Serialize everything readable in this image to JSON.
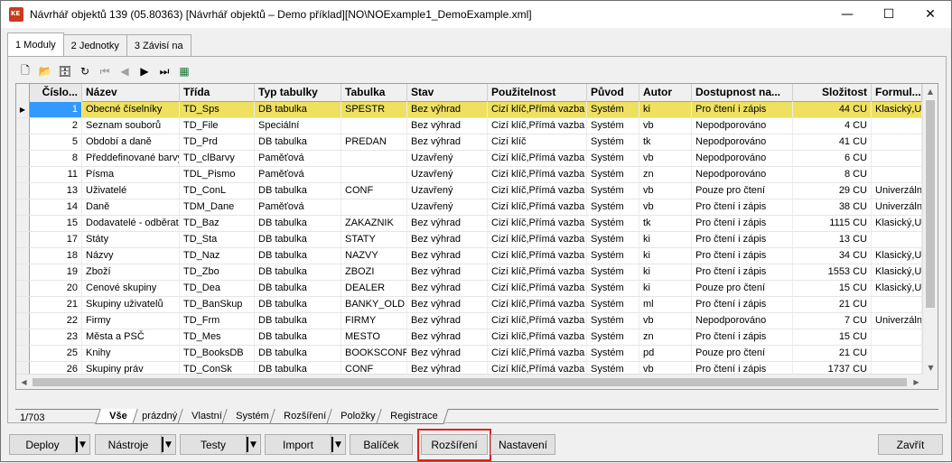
{
  "window": {
    "title": "Návrhář objektů 139 (05.80363) [Návrhář objektů – Demo příklad][NO\\NOExample1_DemoExample.xml]",
    "minimize": "—",
    "maximize": "☐",
    "close": "✕"
  },
  "top_tabs": [
    {
      "label": "1 Moduly",
      "active": true
    },
    {
      "label": "2 Jednotky",
      "active": false
    },
    {
      "label": "3 Závisí na",
      "active": false
    }
  ],
  "toolbar": {
    "icons": [
      "new-document-icon",
      "open-folder-icon",
      "database-icon",
      "refresh-icon",
      "first-record-icon",
      "previous-record-icon",
      "next-record-icon",
      "last-record-icon",
      "excel-export-icon"
    ],
    "glyphs": [
      "🗋",
      "📂",
      "🗄",
      "↻",
      "⏮",
      "◀",
      "▶",
      "⏭",
      "▦"
    ]
  },
  "grid": {
    "columns": [
      "Číslo...",
      "Název",
      "Třída",
      "Typ tabulky",
      "Tabulka",
      "Stav",
      "Použitelnost",
      "Původ",
      "Autor",
      "Dostupnost na...",
      "Složitost",
      "Formul..."
    ],
    "rows": [
      [
        "1",
        "Obecné číselníky",
        "TD_Sps",
        "DB tabulka",
        "SPESTR",
        "Bez výhrad",
        "Cizí klíč,Přímá vazba",
        "Systém",
        "ki",
        "Pro čtení i zápis",
        "44 CU",
        "Klasický,Un"
      ],
      [
        "2",
        "Seznam souborů",
        "TD_File",
        "Speciální",
        "",
        "Bez výhrad",
        "Cizí klíč,Přímá vazba",
        "Systém",
        "vb",
        "Nepodporováno",
        "4 CU",
        ""
      ],
      [
        "5",
        "Období a daně",
        "TD_Prd",
        "DB tabulka",
        "PREDAN",
        "Bez výhrad",
        "Cizí klíč",
        "Systém",
        "tk",
        "Nepodporováno",
        "41 CU",
        ""
      ],
      [
        "8",
        "Předdefinované barvy",
        "TD_clBarvy",
        "Paměťová",
        "",
        "Uzavřený",
        "Cizí klíč,Přímá vazba",
        "Systém",
        "vb",
        "Nepodporováno",
        "6 CU",
        ""
      ],
      [
        "11",
        "Písma",
        "TDL_Pismo",
        "Paměťová",
        "",
        "Uzavřený",
        "Cizí klíč,Přímá vazba",
        "Systém",
        "zn",
        "Nepodporováno",
        "8 CU",
        ""
      ],
      [
        "13",
        "Uživatelé",
        "TD_ConL",
        "DB tabulka",
        "CONF",
        "Uzavřený",
        "Cizí klíč,Přímá vazba",
        "Systém",
        "vb",
        "Pouze pro čtení",
        "29 CU",
        "Univerzální"
      ],
      [
        "14",
        "Daně",
        "TDM_Dane",
        "Paměťová",
        "",
        "Uzavřený",
        "Cizí klíč,Přímá vazba",
        "Systém",
        "vb",
        "Pro čtení i zápis",
        "38 CU",
        "Univerzální"
      ],
      [
        "15",
        "Dodavatelé - odběratelé",
        "TD_Baz",
        "DB tabulka",
        "ZAKAZNIK",
        "Bez výhrad",
        "Cizí klíč,Přímá vazba",
        "Systém",
        "tk",
        "Pro čtení i zápis",
        "1115 CU",
        "Klasický,Un"
      ],
      [
        "17",
        "Státy",
        "TD_Sta",
        "DB tabulka",
        "STATY",
        "Bez výhrad",
        "Cizí klíč,Přímá vazba",
        "Systém",
        "ki",
        "Pro čtení i zápis",
        "13 CU",
        ""
      ],
      [
        "18",
        "Názvy",
        "TD_Naz",
        "DB tabulka",
        "NAZVY",
        "Bez výhrad",
        "Cizí klíč,Přímá vazba",
        "Systém",
        "ki",
        "Pro čtení i zápis",
        "34 CU",
        "Klasický,Un"
      ],
      [
        "19",
        "Zboží",
        "TD_Zbo",
        "DB tabulka",
        "ZBOZI",
        "Bez výhrad",
        "Cizí klíč,Přímá vazba",
        "Systém",
        "ki",
        "Pro čtení i zápis",
        "1553 CU",
        "Klasický,Un"
      ],
      [
        "20",
        "Cenové skupiny",
        "TD_Dea",
        "DB tabulka",
        "DEALER",
        "Bez výhrad",
        "Cizí klíč,Přímá vazba",
        "Systém",
        "ki",
        "Pouze pro čtení",
        "15 CU",
        "Klasický,Un"
      ],
      [
        "21",
        "Skupiny uživatelů",
        "TD_BanSkup",
        "DB tabulka",
        "BANKY_OLD",
        "Bez výhrad",
        "Cizí klíč,Přímá vazba",
        "Systém",
        "ml",
        "Pro čtení i zápis",
        "21 CU",
        ""
      ],
      [
        "22",
        "Firmy",
        "TD_Frm",
        "DB tabulka",
        "FIRMY",
        "Bez výhrad",
        "Cizí klíč,Přímá vazba",
        "Systém",
        "vb",
        "Nepodporováno",
        "7 CU",
        "Univerzální"
      ],
      [
        "23",
        "Města a PSČ",
        "TD_Mes",
        "DB tabulka",
        "MESTO",
        "Bez výhrad",
        "Cizí klíč,Přímá vazba",
        "Systém",
        "zn",
        "Pro čtení i zápis",
        "15 CU",
        ""
      ],
      [
        "25",
        "Knihy",
        "TD_BooksDB",
        "DB tabulka",
        "BOOKSCONFIG",
        "Bez výhrad",
        "Cizí klíč,Přímá vazba",
        "Systém",
        "pd",
        "Pouze pro čtení",
        "21 CU",
        ""
      ],
      [
        "26",
        "Skupiny práv",
        "TD_ConSk",
        "DB tabulka",
        "CONF",
        "Bez výhrad",
        "Cizí klíč,Přímá vazba",
        "Systém",
        "vb",
        "Pro čtení i zápis",
        "1737 CU",
        ""
      ]
    ],
    "selected_row": 0,
    "row_indicator": "▶"
  },
  "status": {
    "record_count": "1/703"
  },
  "bottom_tabs": [
    {
      "label": "Vše",
      "active": true
    },
    {
      "label": "prázdný",
      "active": false
    },
    {
      "label": "Vlastní",
      "active": false
    },
    {
      "label": "Systém",
      "active": false
    },
    {
      "label": "Rozšíření",
      "active": false
    },
    {
      "label": "Položky",
      "active": false
    },
    {
      "label": "Registrace",
      "active": false
    }
  ],
  "buttons": {
    "deploy": "Deploy",
    "tools": "Nástroje",
    "tests": "Testy",
    "import": "Import",
    "package": "Balíček",
    "extensions": "Rozšíření",
    "settings": "Nastavení",
    "close": "Zavřít",
    "dropdown_glyph": "▼"
  },
  "colors": {
    "selected_row": "#f0e060",
    "focus_cell": "#3399ff",
    "highlight_box": "#e02020"
  }
}
